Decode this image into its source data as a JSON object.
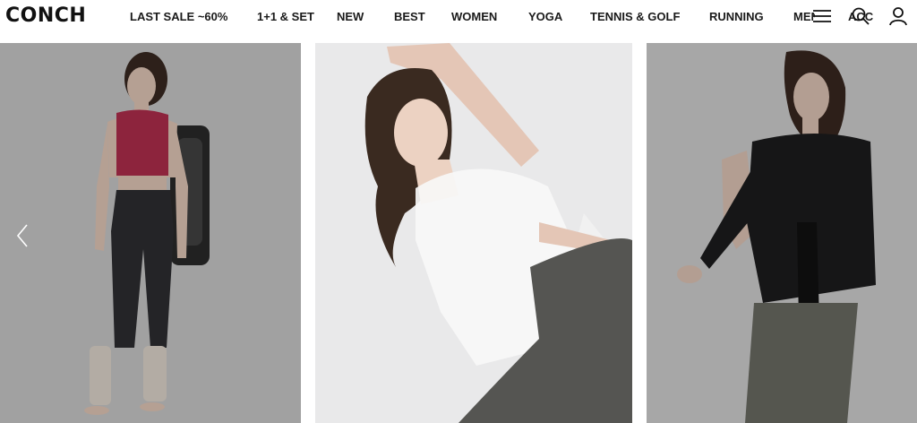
{
  "brand": {
    "logo_text": "CONCH"
  },
  "nav": {
    "items": [
      {
        "label": "LAST SALE ~60%"
      },
      {
        "label": "1+1 & SET"
      },
      {
        "label": "NEW"
      },
      {
        "label": "BEST"
      },
      {
        "label": "WOMEN"
      },
      {
        "label": "YOGA"
      },
      {
        "label": "TENNIS & GOLF"
      },
      {
        "label": "RUNNING"
      },
      {
        "label": "MEN"
      },
      {
        "label": "ACC"
      }
    ]
  },
  "header_icons": [
    "hamburger-menu-icon",
    "search-icon",
    "user-icon"
  ],
  "slider": {
    "prev_icon": "chevron-left-icon",
    "slides": [
      {
        "subject": "woman in pink crop top and charcoal leggings carrying yoga mat bag"
      },
      {
        "subject": "woman in sheer white top and grey leggings stretching"
      },
      {
        "subject": "woman in black long-sleeve wrap top and khaki leggings"
      }
    ]
  },
  "colors": {
    "panel_left_bg": "#9a9a9a",
    "panel_mid_bg": "#e9e9ea",
    "panel_right_bg": "#a6a6a6",
    "text": "#1a1a1a"
  }
}
